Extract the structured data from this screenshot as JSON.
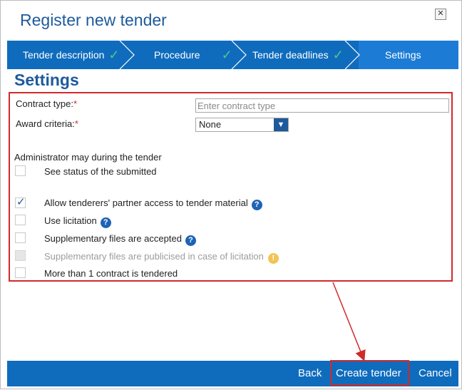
{
  "dialog": {
    "title": "Register new tender"
  },
  "wizard": {
    "steps": [
      {
        "label": "Tender description",
        "done": true
      },
      {
        "label": "Procedure",
        "done": true
      },
      {
        "label": "Tender deadlines",
        "done": true
      },
      {
        "label": "Settings",
        "done": false,
        "active": true
      }
    ],
    "check_symbol": "✓"
  },
  "section": {
    "title": "Settings"
  },
  "form": {
    "contract_type": {
      "label": "Contract type:",
      "required_mark": "*",
      "placeholder": "Enter contract type",
      "value": ""
    },
    "award_criteria": {
      "label": "Award criteria:",
      "required_mark": "*",
      "selected": "None"
    },
    "admin_heading": "Administrator may during the tender",
    "options": [
      {
        "label": "See status of the submitted",
        "checked": false,
        "disabled": false,
        "info": ""
      },
      {
        "label": "Allow tenderers' partner access to tender material",
        "checked": true,
        "disabled": false,
        "info": "help"
      },
      {
        "label": "Use licitation",
        "checked": false,
        "disabled": false,
        "info": "help"
      },
      {
        "label": "Supplementary files are accepted",
        "checked": false,
        "disabled": false,
        "info": "help"
      },
      {
        "label": "Supplementary files are publicised in case of licitation",
        "checked": false,
        "disabled": true,
        "info": "warning"
      },
      {
        "label": "More than 1 contract is tendered",
        "checked": false,
        "disabled": false,
        "info": ""
      }
    ],
    "help_symbol": "?",
    "warn_symbol": "!"
  },
  "footer": {
    "back_label": "Back",
    "create_label": "Create tender",
    "cancel_label": "Cancel"
  },
  "icons": {
    "close": "close-icon",
    "dropdown": "chevron-down-icon",
    "check": "checkmark-icon",
    "help": "help-circle-icon",
    "warning": "warning-circle-icon"
  },
  "colors": {
    "accent": "#0f6cbd",
    "title": "#1d5a9c",
    "highlight": "#d02a2a",
    "done_check": "#4fc58d"
  }
}
